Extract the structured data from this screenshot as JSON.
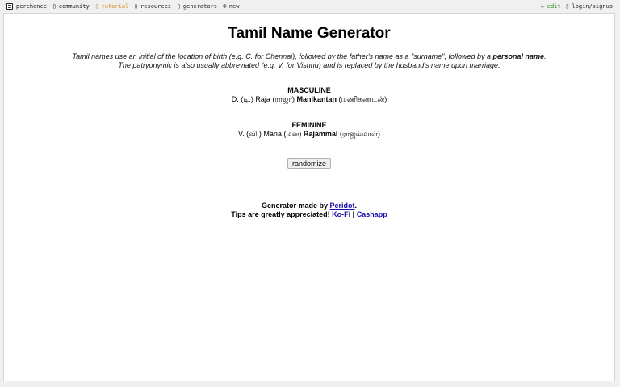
{
  "nav": {
    "home": "perchance",
    "community": "community",
    "tutorial": "tutorial",
    "resources": "resources",
    "generators": "generators",
    "new": "new",
    "edit": "edit",
    "login": "login/signup"
  },
  "icons": {
    "home": "dice-icon",
    "community": "chat-icon",
    "tutorial": "book-icon",
    "resources": "link-icon",
    "generators": "list-icon",
    "new": "plus-circle-icon",
    "edit": "pencil-icon",
    "login": "user-icon"
  },
  "page": {
    "title": "Tamil Name Generator",
    "intro": {
      "line1_text": "Tamil names use an initial of the location of birth (e.g. C. for Chennai), followed by the father's name as a \"surname\", followed by a ",
      "line1_bold": "personal name",
      "line1_end": ".",
      "line2": "The patryonymic is also usually abbreviated (e.g. V. for Vishnu) and is replaced by the husband's name upon marriage."
    },
    "masculine": {
      "heading": "MASCULINE",
      "prefix": "D. (டி.) Raja (ராஜா) ",
      "given": "Manikantan",
      "given_tamil": " (மணிகண்டன்)"
    },
    "feminine": {
      "heading": "FEMININE",
      "prefix": "V. (வி.) Mana (மன) ",
      "given": "Rajammal",
      "given_tamil": " (ராஜம்மாள்)"
    },
    "randomize_label": "randomize",
    "credits": {
      "made_by": "Generator made by ",
      "author": "Peridot",
      "period": ".",
      "tips": "Tips are greatly appreciated! ",
      "kofi": "Ko-Fi",
      "sep": " | ",
      "cashapp": "Cashapp"
    }
  },
  "colors": {
    "tutorial": "#d98a1f",
    "edit": "#2a8a2a",
    "link": "#1a0dab"
  }
}
